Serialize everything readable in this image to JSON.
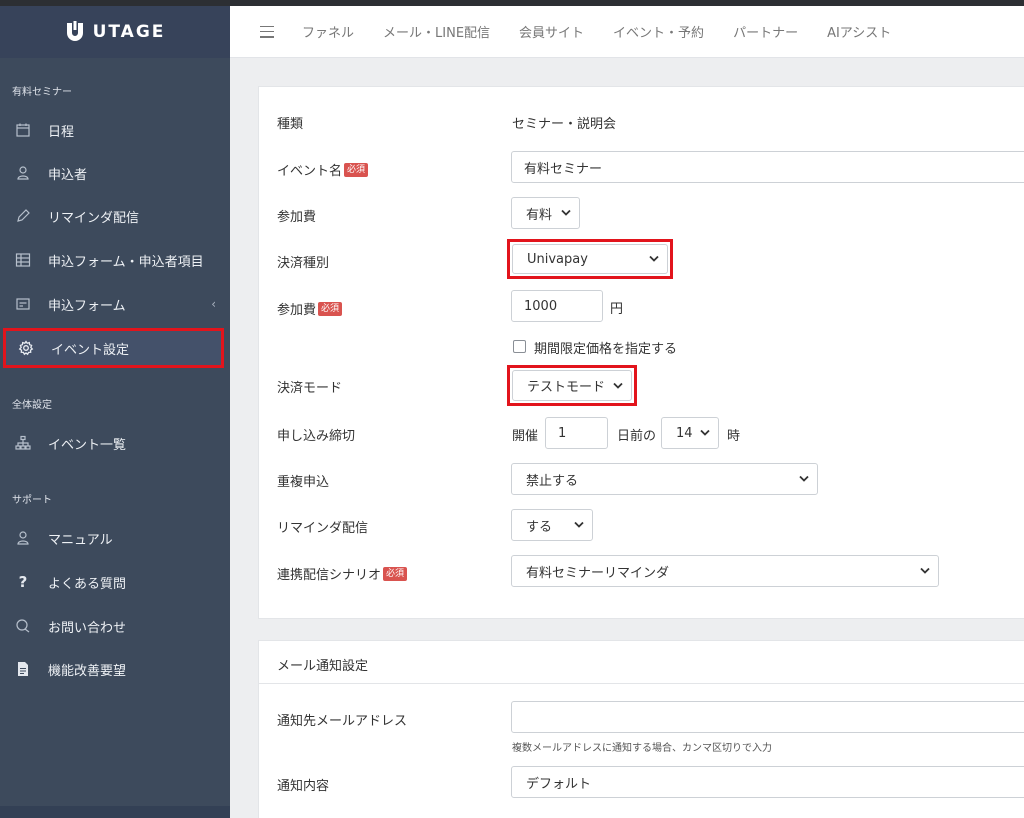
{
  "brand": {
    "name": "UTAGE"
  },
  "sidebar": {
    "section1": "有料セミナー",
    "items1": [
      {
        "label": "日程",
        "icon": "calendar-icon"
      },
      {
        "label": "申込者",
        "icon": "user-icon"
      },
      {
        "label": "リマインダ配信",
        "icon": "pencil-icon"
      },
      {
        "label": "申込フォーム・申込者項目",
        "icon": "table-icon"
      },
      {
        "label": "申込フォーム",
        "icon": "form-icon",
        "chevron": "‹"
      },
      {
        "label": "イベント設定",
        "icon": "gear-icon"
      }
    ],
    "section2": "全体設定",
    "items2": [
      {
        "label": "イベント一覧",
        "icon": "sitemap-icon"
      }
    ],
    "section3": "サポート",
    "items3": [
      {
        "label": "マニュアル",
        "icon": "user-icon"
      },
      {
        "label": "よくある質問",
        "icon": "question-icon"
      },
      {
        "label": "お問い合わせ",
        "icon": "chat-icon"
      },
      {
        "label": "機能改善要望",
        "icon": "document-icon"
      }
    ]
  },
  "topnav": {
    "links": [
      "ファネル",
      "メール・LINE配信",
      "会員サイト",
      "イベント・予約",
      "パートナー",
      "AIアシスト"
    ]
  },
  "required_badge": "必須",
  "form": {
    "type": {
      "label": "種類",
      "value": "セミナー・説明会"
    },
    "event_name": {
      "label": "イベント名",
      "value": "有料セミナー"
    },
    "fee_type": {
      "label": "参加費",
      "value": "有料"
    },
    "payment_type": {
      "label": "決済種別",
      "value": "Univapay"
    },
    "fee": {
      "label": "参加費",
      "value": "1000",
      "unit": "円"
    },
    "limited_price": {
      "label": "期間限定価格を指定する"
    },
    "payment_mode": {
      "label": "決済モード",
      "value": "テストモード"
    },
    "deadline": {
      "label": "申し込み締切",
      "prefix": "開催",
      "days": "1",
      "mid": "日前の",
      "hour": "14",
      "suffix": "時"
    },
    "duplicate": {
      "label": "重複申込",
      "value": "禁止する"
    },
    "reminder": {
      "label": "リマインダ配信",
      "value": "する"
    },
    "scenario": {
      "label": "連携配信シナリオ",
      "value": "有料セミナーリマインダ"
    }
  },
  "mail": {
    "title": "メール通知設定",
    "address": {
      "label": "通知先メールアドレス",
      "value": "",
      "help": "複数メールアドレスに通知する場合、カンマ区切りで入力"
    },
    "content": {
      "label": "通知内容",
      "value": "デフォルト"
    }
  }
}
